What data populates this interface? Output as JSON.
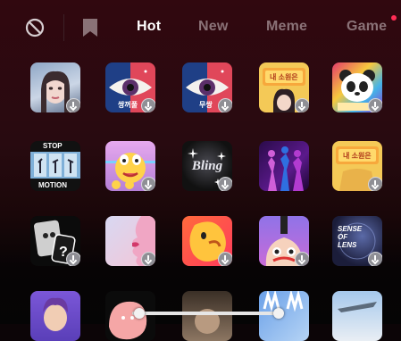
{
  "tabs": [
    {
      "label": "Hot",
      "active": true
    },
    {
      "label": "New",
      "active": false
    },
    {
      "label": "Meme",
      "active": false
    },
    {
      "label": "Game",
      "active": false,
      "badge": true
    }
  ],
  "icons": {
    "clear": "ban-icon",
    "favorites": "bookmark-icon",
    "download": "download-icon"
  },
  "effects": {
    "stop_motion": {
      "line1": "STOP",
      "line2": "MOTION"
    },
    "bling": "Bling",
    "sense_of_lens": {
      "line1": "SENSE",
      "line2": "OF",
      "line3": "LENS"
    },
    "label_korean_1": "내 소원은",
    "label_korean_2": "내 소원은",
    "label_korean_3": "내 소원은",
    "eye_label_1": "쌍꺼풀",
    "eye_label_2": "무쌍"
  },
  "colors": {
    "accent": "#ff2d55",
    "active_tab": "#ffffff",
    "inactive_tab": "#8a7277"
  }
}
